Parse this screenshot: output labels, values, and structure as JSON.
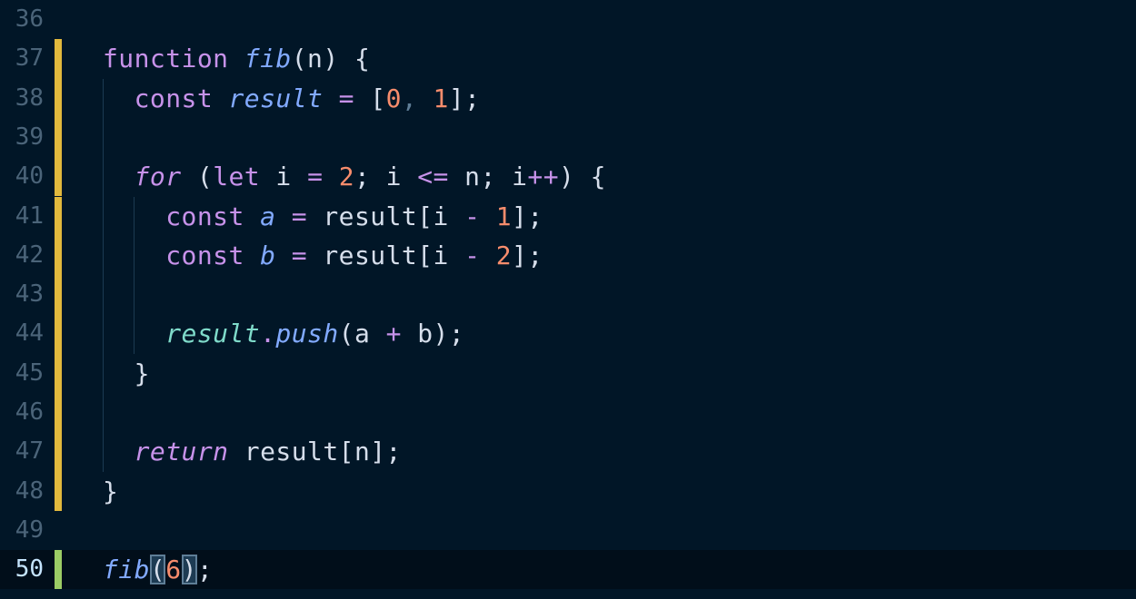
{
  "editor": {
    "lines": [
      {
        "num": "36",
        "change": null,
        "tokens": []
      },
      {
        "num": "37",
        "change": "modified",
        "tokens": [
          {
            "t": "function",
            "c": "tok-kw"
          },
          {
            "t": " ",
            "c": "tok-plain"
          },
          {
            "t": "fib",
            "c": "tok-fn-it"
          },
          {
            "t": "(n) {",
            "c": "tok-punc"
          }
        ]
      },
      {
        "num": "38",
        "change": "modified",
        "tokens": [
          {
            "t": "  ",
            "c": "tok-plain"
          },
          {
            "t": "const",
            "c": "tok-kw"
          },
          {
            "t": " ",
            "c": "tok-plain"
          },
          {
            "t": "result",
            "c": "tok-var-it"
          },
          {
            "t": " ",
            "c": "tok-plain"
          },
          {
            "t": "=",
            "c": "tok-op"
          },
          {
            "t": " [",
            "c": "tok-punc"
          },
          {
            "t": "0",
            "c": "tok-num"
          },
          {
            "t": ",",
            "c": "tok-comma"
          },
          {
            "t": " ",
            "c": "tok-plain"
          },
          {
            "t": "1",
            "c": "tok-num"
          },
          {
            "t": "];",
            "c": "tok-punc"
          }
        ]
      },
      {
        "num": "39",
        "change": "modified",
        "tokens": []
      },
      {
        "num": "40",
        "change": "modified",
        "tokens": [
          {
            "t": "  ",
            "c": "tok-plain"
          },
          {
            "t": "for",
            "c": "tok-kw-it"
          },
          {
            "t": " (",
            "c": "tok-punc"
          },
          {
            "t": "let",
            "c": "tok-kw"
          },
          {
            "t": " i ",
            "c": "tok-plain"
          },
          {
            "t": "=",
            "c": "tok-op"
          },
          {
            "t": " ",
            "c": "tok-plain"
          },
          {
            "t": "2",
            "c": "tok-num"
          },
          {
            "t": "; i ",
            "c": "tok-punc"
          },
          {
            "t": "<=",
            "c": "tok-op"
          },
          {
            "t": " n; i",
            "c": "tok-punc"
          },
          {
            "t": "++",
            "c": "tok-op"
          },
          {
            "t": ") {",
            "c": "tok-punc"
          }
        ]
      },
      {
        "num": "41",
        "change": "modified",
        "tokens": [
          {
            "t": "    ",
            "c": "tok-plain"
          },
          {
            "t": "const",
            "c": "tok-kw"
          },
          {
            "t": " ",
            "c": "tok-plain"
          },
          {
            "t": "a",
            "c": "tok-var-it"
          },
          {
            "t": " ",
            "c": "tok-plain"
          },
          {
            "t": "=",
            "c": "tok-op"
          },
          {
            "t": " result[i ",
            "c": "tok-punc"
          },
          {
            "t": "-",
            "c": "tok-op"
          },
          {
            "t": " ",
            "c": "tok-plain"
          },
          {
            "t": "1",
            "c": "tok-num"
          },
          {
            "t": "];",
            "c": "tok-punc"
          }
        ]
      },
      {
        "num": "42",
        "change": "modified",
        "tokens": [
          {
            "t": "    ",
            "c": "tok-plain"
          },
          {
            "t": "const",
            "c": "tok-kw"
          },
          {
            "t": " ",
            "c": "tok-plain"
          },
          {
            "t": "b",
            "c": "tok-var-it"
          },
          {
            "t": " ",
            "c": "tok-plain"
          },
          {
            "t": "=",
            "c": "tok-op"
          },
          {
            "t": " result[i ",
            "c": "tok-punc"
          },
          {
            "t": "-",
            "c": "tok-op"
          },
          {
            "t": " ",
            "c": "tok-plain"
          },
          {
            "t": "2",
            "c": "tok-num"
          },
          {
            "t": "];",
            "c": "tok-punc"
          }
        ]
      },
      {
        "num": "43",
        "change": "modified",
        "tokens": []
      },
      {
        "num": "44",
        "change": "modified",
        "tokens": [
          {
            "t": "    ",
            "c": "tok-plain"
          },
          {
            "t": "result",
            "c": "tok-obj-it"
          },
          {
            "t": ".",
            "c": "tok-op"
          },
          {
            "t": "push",
            "c": "tok-fn-it"
          },
          {
            "t": "(a ",
            "c": "tok-punc"
          },
          {
            "t": "+",
            "c": "tok-op"
          },
          {
            "t": " b);",
            "c": "tok-punc"
          }
        ]
      },
      {
        "num": "45",
        "change": "modified",
        "tokens": [
          {
            "t": "  }",
            "c": "tok-punc"
          }
        ]
      },
      {
        "num": "46",
        "change": "modified",
        "tokens": []
      },
      {
        "num": "47",
        "change": "modified",
        "tokens": [
          {
            "t": "  ",
            "c": "tok-plain"
          },
          {
            "t": "return",
            "c": "tok-kw-it"
          },
          {
            "t": " result[n];",
            "c": "tok-punc"
          }
        ]
      },
      {
        "num": "48",
        "change": "modified",
        "tokens": [
          {
            "t": "}",
            "c": "tok-punc"
          }
        ]
      },
      {
        "num": "49",
        "change": null,
        "tokens": []
      },
      {
        "num": "50",
        "change": "added",
        "active": true,
        "tokens": [
          {
            "t": "fib",
            "c": "tok-fn-it"
          },
          {
            "t": "(",
            "c": "tok-punc",
            "match": true
          },
          {
            "t": "6",
            "c": "tok-num"
          },
          {
            "t": ")",
            "c": "tok-punc",
            "match": true
          },
          {
            "t": ";",
            "c": "tok-punc"
          }
        ]
      }
    ]
  },
  "colors": {
    "background": "#011627",
    "active_line": "#010e1a",
    "modified_bar": "#e2b93d",
    "added_bar": "#9ccc65",
    "line_number": "#4b6479",
    "line_number_active": "#c5e4fd"
  }
}
